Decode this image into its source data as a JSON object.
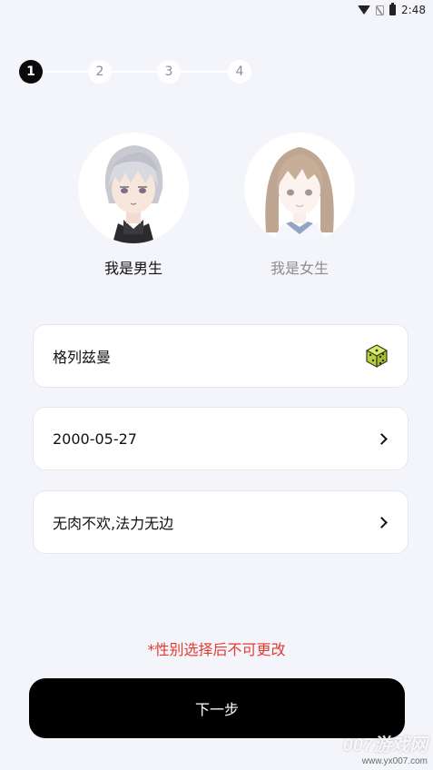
{
  "status_bar": {
    "time": "2:48"
  },
  "steps": [
    "1",
    "2",
    "3",
    "4"
  ],
  "active_step": 1,
  "gender": {
    "male_label": "我是男生",
    "female_label": "我是女生",
    "selected": "male"
  },
  "form": {
    "nickname": "格列兹曼",
    "birthday": "2000-05-27",
    "signature": "无肉不欢,法力无边"
  },
  "notice": "*性别选择后不可更改",
  "next_button": "下一步",
  "watermark": {
    "title": "007游戏网",
    "url": "www.yx007.com"
  },
  "colors": {
    "background": "#f4f5fa",
    "accent": "#000000",
    "warning": "#e23b2f",
    "dice": "#c5dc4a"
  }
}
